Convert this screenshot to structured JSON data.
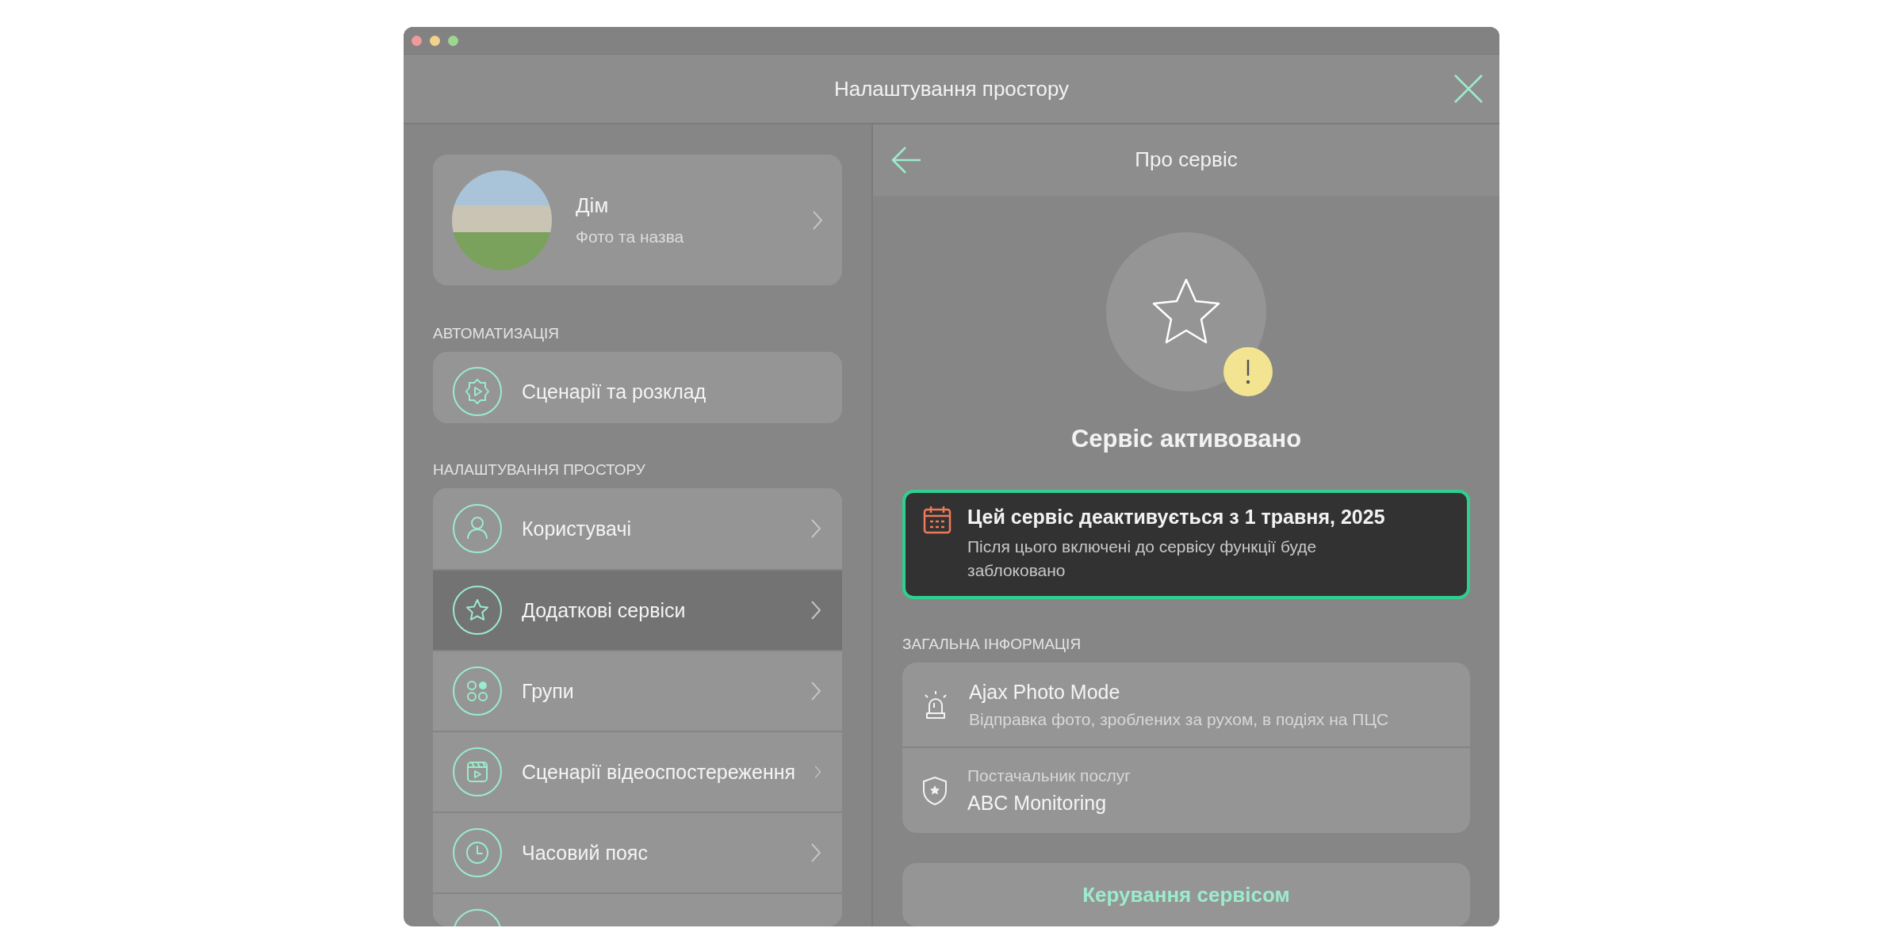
{
  "window": {
    "title": "Налаштування простору"
  },
  "profile": {
    "name": "Дім",
    "subtitle": "Фото та назва"
  },
  "automation": {
    "label": "АВТОМАТИЗАЦІЯ",
    "items": [
      {
        "kind": "gear-play",
        "label": "Сценарії та розклад",
        "chevron": false
      }
    ]
  },
  "space_settings": {
    "label": "НАЛАШТУВАННЯ ПРОСТОРУ",
    "items": [
      {
        "kind": "user",
        "label": "Користувачі",
        "selected": false
      },
      {
        "kind": "star",
        "label": "Додаткові сервіси",
        "selected": true
      },
      {
        "kind": "groups",
        "label": "Групи",
        "selected": false
      },
      {
        "kind": "video",
        "label": "Сценарії відеоспостереження",
        "selected": false
      },
      {
        "kind": "clock",
        "label": "Часовий пояс",
        "selected": false
      },
      {
        "kind": "blank",
        "selected": false
      }
    ]
  },
  "detail": {
    "title": "Про сервіс",
    "status": "Сервіс активовано",
    "notice": {
      "title": "Цей сервіс деактивується з 1 травня, 2025",
      "text": "Після цього включені до сервісу функції буде заблоковано"
    },
    "info_label": "ЗАГАЛЬНА ІНФОРМАЦІЯ",
    "info": [
      {
        "kind": "siren",
        "title": "Ajax Photo Mode",
        "text": "Відправка фото, зроблених за рухом, в подіях на ПЦС"
      },
      {
        "kind": "shield",
        "title": "ABC Monitoring",
        "text": "Постачальник послуг"
      }
    ],
    "button": "Керування сервісом"
  }
}
